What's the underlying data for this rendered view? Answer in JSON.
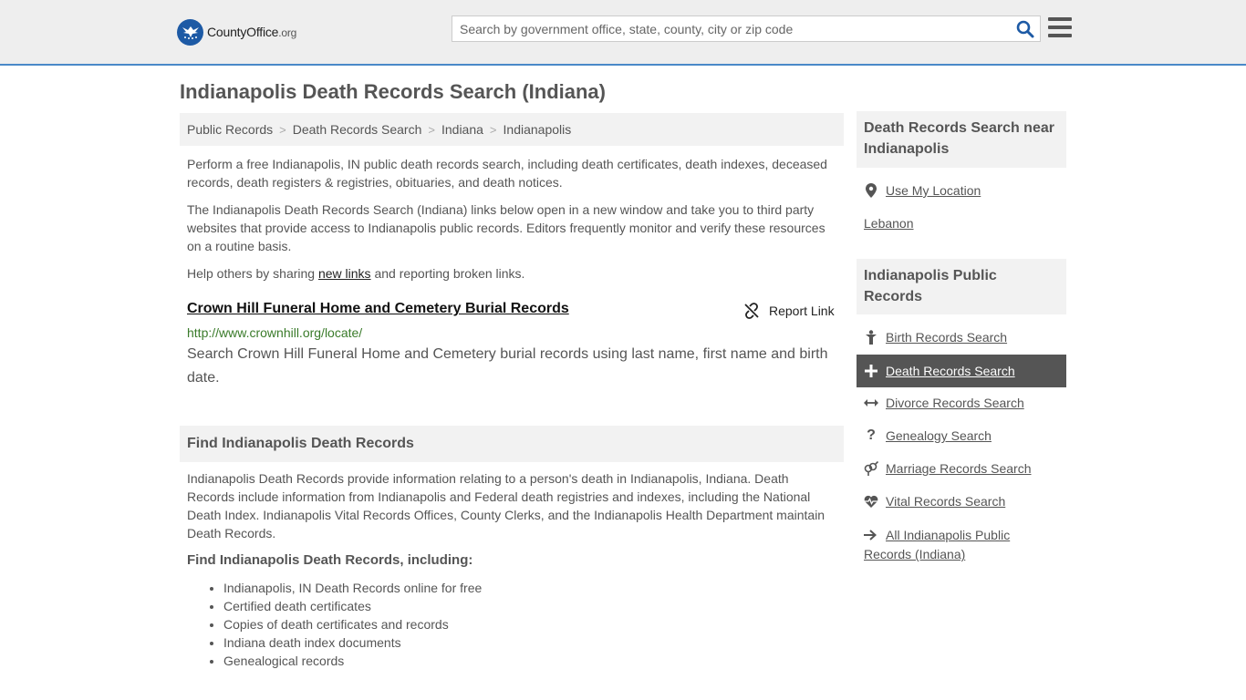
{
  "header": {
    "logo_main": "CountyOffice",
    "logo_suffix": ".org",
    "search_placeholder": "Search by government office, state, county, city or zip code"
  },
  "page_title": "Indianapolis Death Records Search (Indiana)",
  "breadcrumb": [
    "Public Records",
    "Death Records Search",
    "Indiana",
    "Indianapolis"
  ],
  "intro": {
    "p1": "Perform a free Indianapolis, IN public death records search, including death certificates, death indexes, deceased records, death registers & registries, obituaries, and death notices.",
    "p2": "The Indianapolis Death Records Search (Indiana) links below open in a new window and take you to third party websites that provide access to Indianapolis public records. Editors frequently monitor and verify these resources on a routine basis.",
    "p3_before": "Help others by sharing ",
    "p3_link": "new links",
    "p3_after": " and reporting broken links."
  },
  "result": {
    "title": "Crown Hill Funeral Home and Cemetery Burial Records",
    "report_label": "Report Link",
    "url": "http://www.crownhill.org/locate/",
    "description": "Search Crown Hill Funeral Home and Cemetery burial records using last name, first name and birth date."
  },
  "find_section": {
    "heading": "Find Indianapolis Death Records",
    "body": "Indianapolis Death Records provide information relating to a person's death in Indianapolis, Indiana. Death Records include information from Indianapolis and Federal death registries and indexes, including the National Death Index. Indianapolis Vital Records Offices, County Clerks, and the Indianapolis Health Department maintain Death Records.",
    "subheading": "Find Indianapolis Death Records, including:",
    "items": [
      "Indianapolis, IN Death Records online for free",
      "Certified death certificates",
      "Copies of death certificates and records",
      "Indiana death index documents",
      "Genealogical records"
    ]
  },
  "sidebar": {
    "near_heading": "Death Records Search near Indianapolis",
    "use_location": "Use My Location",
    "nearby": "Lebanon",
    "public_heading": "Indianapolis Public Records",
    "links": [
      {
        "label": "Birth Records Search",
        "icon": "birth-icon"
      },
      {
        "label": "Death Records Search",
        "icon": "plus-icon",
        "active": true
      },
      {
        "label": "Divorce Records Search",
        "icon": "arrows-icon"
      },
      {
        "label": "Genealogy Search",
        "icon": "question-icon"
      },
      {
        "label": "Marriage Records Search",
        "icon": "gender-icon"
      },
      {
        "label": "Vital Records Search",
        "icon": "heartbeat-icon"
      }
    ],
    "all_link": "All Indianapolis Public Records (Indiana)"
  },
  "colors": {
    "header_bg": "#eeeeee",
    "header_border": "#4a89c8",
    "logo_blue": "#1d5aa5",
    "search_icon": "#1d5aa5",
    "url_green": "#3a7b2a",
    "active_bg": "#555555"
  }
}
